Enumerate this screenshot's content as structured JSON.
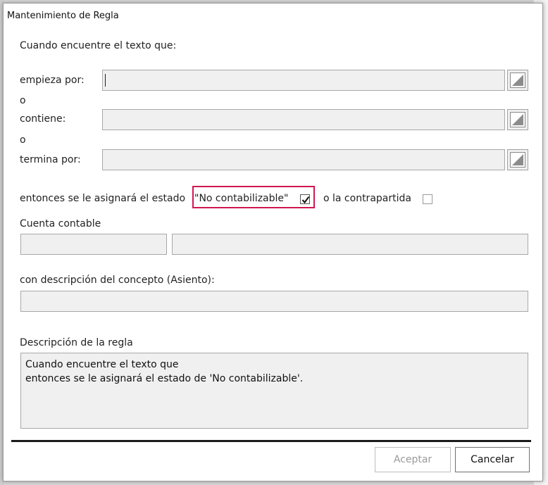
{
  "dialog": {
    "title": "Mantenimiento de Regla",
    "intro": "Cuando encuentre el texto que:",
    "starts_with_label": "empieza por:",
    "starts_with_value": "",
    "or1": "o",
    "contains_label": "contiene:",
    "contains_value": "",
    "or2": "o",
    "ends_with_label": "termina por:",
    "ends_with_value": "",
    "then_label": "entonces se le asignará el estado",
    "status_option": "\"No contabilizable\"",
    "status_checked": true,
    "counterpart_label": "o la contrapartida",
    "counterpart_checked": false,
    "account_label": "Cuenta contable",
    "account_code_value": "",
    "account_name_value": "",
    "concept_label": "con descripción del concepto (Asiento):",
    "concept_value": "",
    "rule_desc_label": "Descripción de la regla",
    "rule_desc_lines": [
      "Cuando encuentre el texto que",
      "entonces se le asignará el estado de 'No contabilizable'."
    ],
    "accept_label": "Aceptar",
    "cancel_label": "Cancelar"
  },
  "colors": {
    "highlight": "#d0174f",
    "field_bg": "#f0f0f0"
  },
  "icons": {
    "expand": "expand-editor-icon",
    "check": "checkmark-icon"
  }
}
